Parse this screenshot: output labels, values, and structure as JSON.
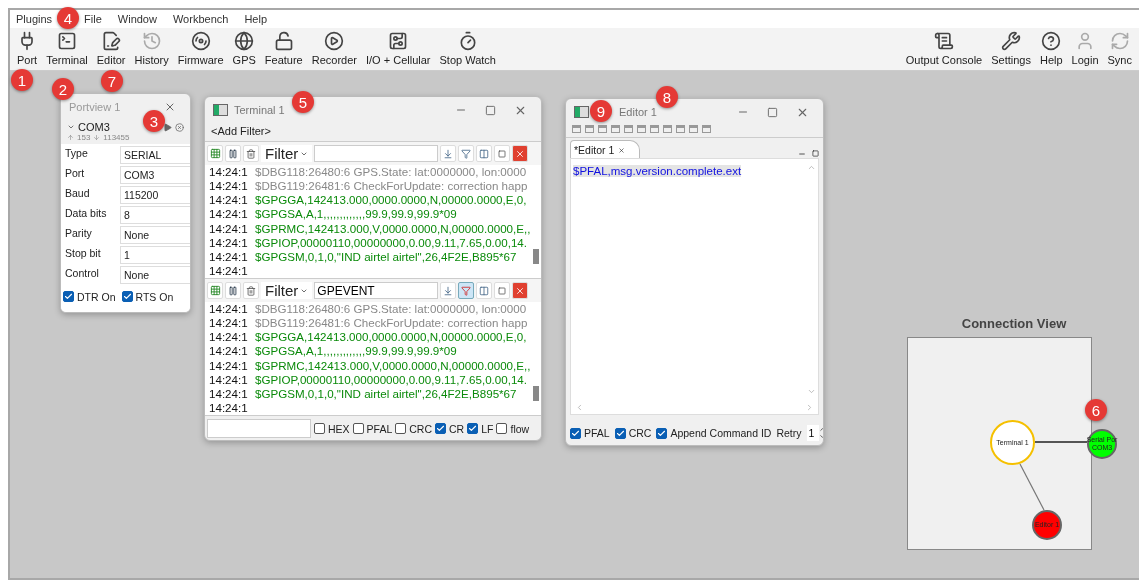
{
  "menu": [
    "Plugins",
    "File",
    "Window",
    "Workbench",
    "Help"
  ],
  "toolbar_left": [
    {
      "label": "Port"
    },
    {
      "label": "Terminal"
    },
    {
      "label": "Editor"
    },
    {
      "label": "History"
    },
    {
      "label": "Firmware"
    },
    {
      "label": "GPS"
    },
    {
      "label": "Feature"
    },
    {
      "label": "Recorder"
    },
    {
      "label": "I/O + Cellular"
    },
    {
      "label": "Stop Watch"
    }
  ],
  "toolbar_right": [
    {
      "label": "Output Console"
    },
    {
      "label": "Settings"
    },
    {
      "label": "Help"
    },
    {
      "label": "Login"
    },
    {
      "label": "Sync"
    }
  ],
  "portview": {
    "title": "Portview 1",
    "port": "COM3",
    "sent": "153",
    "received": "113455",
    "fields": [
      {
        "label": "Type",
        "value": "SERIAL"
      },
      {
        "label": "Port",
        "value": "COM3"
      },
      {
        "label": "Baud",
        "value": "115200"
      },
      {
        "label": "Data bits",
        "value": "8"
      },
      {
        "label": "Parity",
        "value": "None"
      },
      {
        "label": "Stop bit",
        "value": "1"
      },
      {
        "label": "Control",
        "value": "None"
      }
    ],
    "options": [
      {
        "label": "DTR On",
        "checked": true
      },
      {
        "label": "RTS On",
        "checked": true
      }
    ]
  },
  "terminal": {
    "title": "Terminal 1",
    "add_filter": "<Add Filter>",
    "panes": [
      {
        "filter_label": "Filter",
        "filter_active": false,
        "lines": [
          {
            "time": "14:24:1",
            "kind": "debug",
            "text": "$DBG118:26480:6 GPS.State: lat:0000000, lon:0000"
          },
          {
            "time": "14:24:1",
            "kind": "debug",
            "text": "$DBG119:26481:6 CheckForUpdate: correction happ"
          },
          {
            "time": "14:24:1",
            "kind": "nmea",
            "text": "$GPGGA,142413.000,0000.0000,N,00000.0000,E,0,"
          },
          {
            "time": "14:24:1",
            "kind": "nmea",
            "text": "$GPGSA,A,1,,,,,,,,,,,,,99.9,99.9,99.9*09"
          },
          {
            "time": "14:24:1",
            "kind": "nmea",
            "text": "$GPRMC,142413.000,V,0000.0000,N,00000.0000,E,,"
          },
          {
            "time": "14:24:1",
            "kind": "nmea",
            "text": "$GPIOP,00000110,00000000,0.00,9.11,7.65,0.00,14."
          },
          {
            "time": "14:24:1",
            "kind": "nmea",
            "text": "$GPGSM,0,1,0,\"IND airtel airtel\",26,4F2E,B895*67"
          },
          {
            "time": "14:24:1"
          }
        ]
      },
      {
        "filter_label": "Filter",
        "filter_value": "GPEVENT",
        "filter_active": true,
        "lines": [
          {
            "time": "14:24:1",
            "kind": "debug",
            "text": "$DBG118:26480:6 GPS.State: lat:0000000, lon:0000"
          },
          {
            "time": "14:24:1",
            "kind": "debug",
            "text": "$DBG119:26481:6 CheckForUpdate: correction happ"
          },
          {
            "time": "14:24:1",
            "kind": "nmea",
            "text": "$GPGGA,142413.000,0000.0000,N,00000.0000,E,0,"
          },
          {
            "time": "14:24:1",
            "kind": "nmea",
            "text": "$GPGSA,A,1,,,,,,,,,,,,,99.9,99.9,99.9*09"
          },
          {
            "time": "14:24:1",
            "kind": "nmea",
            "text": "$GPRMC,142413.000,V,0000.0000,N,00000.0000,E,,"
          },
          {
            "time": "14:24:1",
            "kind": "nmea",
            "text": "$GPIOP,00000110,00000000,0.00,9.11,7.65,0.00,14."
          },
          {
            "time": "14:24:1",
            "kind": "nmea",
            "text": "$GPGSM,0,1,0,\"IND airtel airtel\",26,4F2E,B895*67"
          },
          {
            "time": "14:24:1"
          }
        ]
      }
    ],
    "options": [
      {
        "label": "HEX",
        "checked": false
      },
      {
        "label": "PFAL",
        "checked": false
      },
      {
        "label": "CRC",
        "checked": false
      },
      {
        "label": "CR",
        "checked": true
      },
      {
        "label": "LF",
        "checked": true
      },
      {
        "label": "flow",
        "checked": false
      }
    ]
  },
  "editor": {
    "title": "Editor 1",
    "tab": "*Editor 1",
    "content": "$PFAL,msg.version.complete.ext",
    "content_selected": true,
    "options": [
      {
        "label": "PFAL",
        "checked": true
      },
      {
        "label": "CRC",
        "checked": true
      },
      {
        "label": "Append Command ID",
        "checked": true
      }
    ],
    "retry_label": "Retry",
    "retry_value": "1"
  },
  "connection_view": {
    "title": "Connection View",
    "nodes": [
      {
        "label": "Terminal 1",
        "color": "#ffffff"
      },
      {
        "label": "Serial Por",
        "label_2": "COM3",
        "color": "#00ff00"
      },
      {
        "label": "Editor 1",
        "color": "#ff0000"
      }
    ]
  },
  "callouts": [
    "1",
    "2",
    "3",
    "4",
    "5",
    "6",
    "7",
    "8",
    "9"
  ]
}
